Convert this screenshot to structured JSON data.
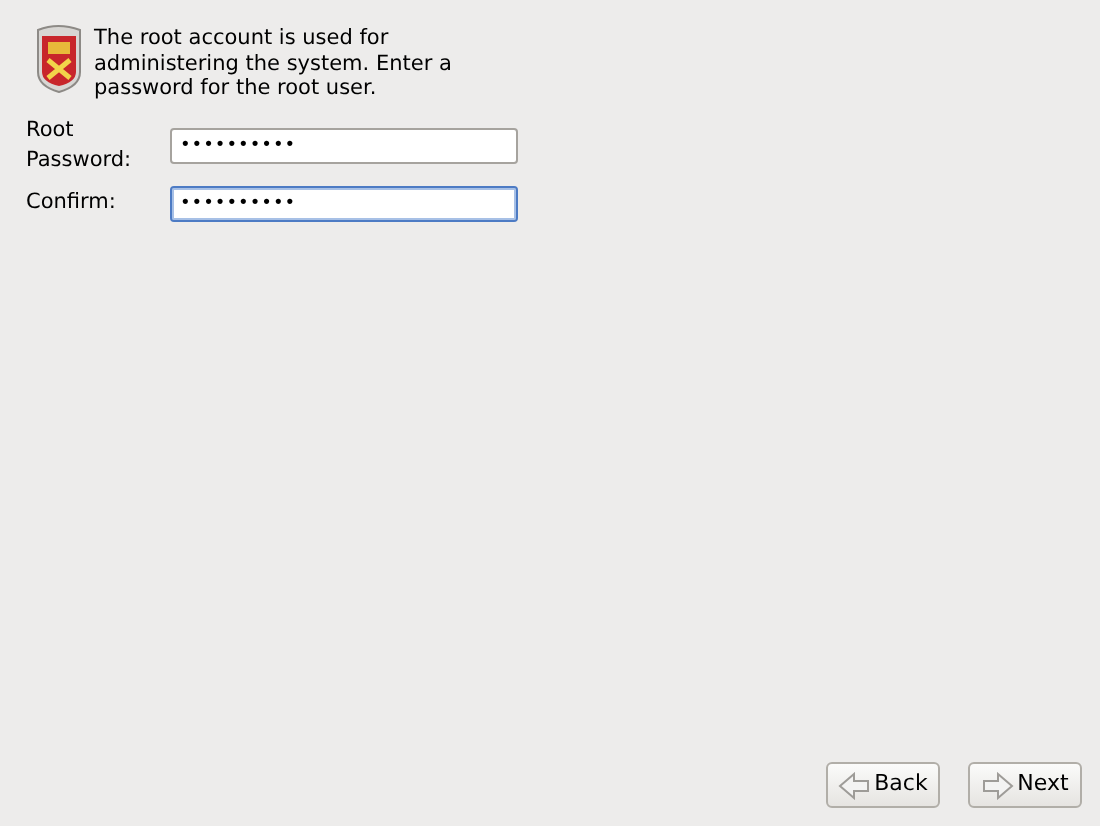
{
  "intro": "The root account is used for administering the system.  Enter a password for the root user.",
  "fields": [
    {
      "label": "Root Password:",
      "value": "••••••••••",
      "focused": false
    },
    {
      "label": "Confirm:",
      "value": "••••••••••",
      "focused": true
    }
  ],
  "buttons": [
    {
      "label": "Back",
      "kind": "back"
    },
    {
      "label": "Next",
      "kind": "next"
    }
  ]
}
